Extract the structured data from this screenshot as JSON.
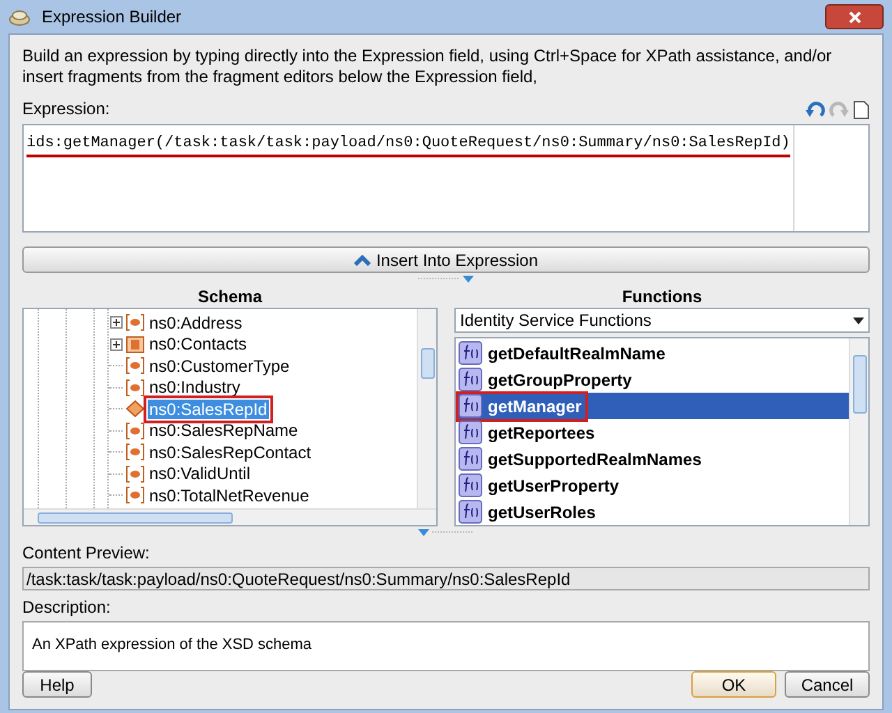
{
  "window": {
    "title": "Expression Builder"
  },
  "intro": "Build an expression by typing directly into the Expression field, using Ctrl+Space for XPath assistance, and/or insert fragments from the fragment editors below the Expression field,",
  "expression": {
    "label": "Expression:",
    "value": "ids:getManager(/task:task/task:payload/ns0:QuoteRequest/ns0:Summary/ns0:SalesRepId)",
    "underlined": true
  },
  "insert_button": "Insert Into Expression",
  "schema": {
    "title": "Schema",
    "items": [
      {
        "label": "ns0:Address",
        "expandable": true,
        "kind": "element",
        "selected": false,
        "annotated": false
      },
      {
        "label": "ns0:Contacts",
        "expandable": true,
        "kind": "complex",
        "selected": false,
        "annotated": false
      },
      {
        "label": "ns0:CustomerType",
        "expandable": false,
        "kind": "element",
        "selected": false,
        "annotated": false
      },
      {
        "label": "ns0:Industry",
        "expandable": false,
        "kind": "element",
        "selected": false,
        "annotated": false
      },
      {
        "label": "ns0:SalesRepId",
        "expandable": false,
        "kind": "element",
        "selected": true,
        "annotated": true
      },
      {
        "label": "ns0:SalesRepName",
        "expandable": false,
        "kind": "element",
        "selected": false,
        "annotated": false
      },
      {
        "label": "ns0:SalesRepContact",
        "expandable": false,
        "kind": "element",
        "selected": false,
        "annotated": false
      },
      {
        "label": "ns0:ValidUntil",
        "expandable": false,
        "kind": "element",
        "selected": false,
        "annotated": false
      },
      {
        "label": "ns0:TotalNetRevenue",
        "expandable": false,
        "kind": "element",
        "selected": false,
        "annotated": false
      }
    ]
  },
  "functions": {
    "title": "Functions",
    "category": "Identity Service Functions",
    "items": [
      {
        "label": "getDefaultRealmName",
        "selected": false,
        "annotated": false
      },
      {
        "label": "getGroupProperty",
        "selected": false,
        "annotated": false
      },
      {
        "label": "getManager",
        "selected": true,
        "annotated": true
      },
      {
        "label": "getReportees",
        "selected": false,
        "annotated": false
      },
      {
        "label": "getSupportedRealmNames",
        "selected": false,
        "annotated": false
      },
      {
        "label": "getUserProperty",
        "selected": false,
        "annotated": false
      },
      {
        "label": "getUserRoles",
        "selected": false,
        "annotated": false
      }
    ]
  },
  "content_preview": {
    "label": "Content Preview:",
    "value": "/task:task/task:payload/ns0:QuoteRequest/ns0:Summary/ns0:SalesRepId"
  },
  "description": {
    "label": "Description:",
    "value": "An XPath expression of the XSD schema"
  },
  "buttons": {
    "help": "Help",
    "ok": "OK",
    "cancel": "Cancel"
  }
}
